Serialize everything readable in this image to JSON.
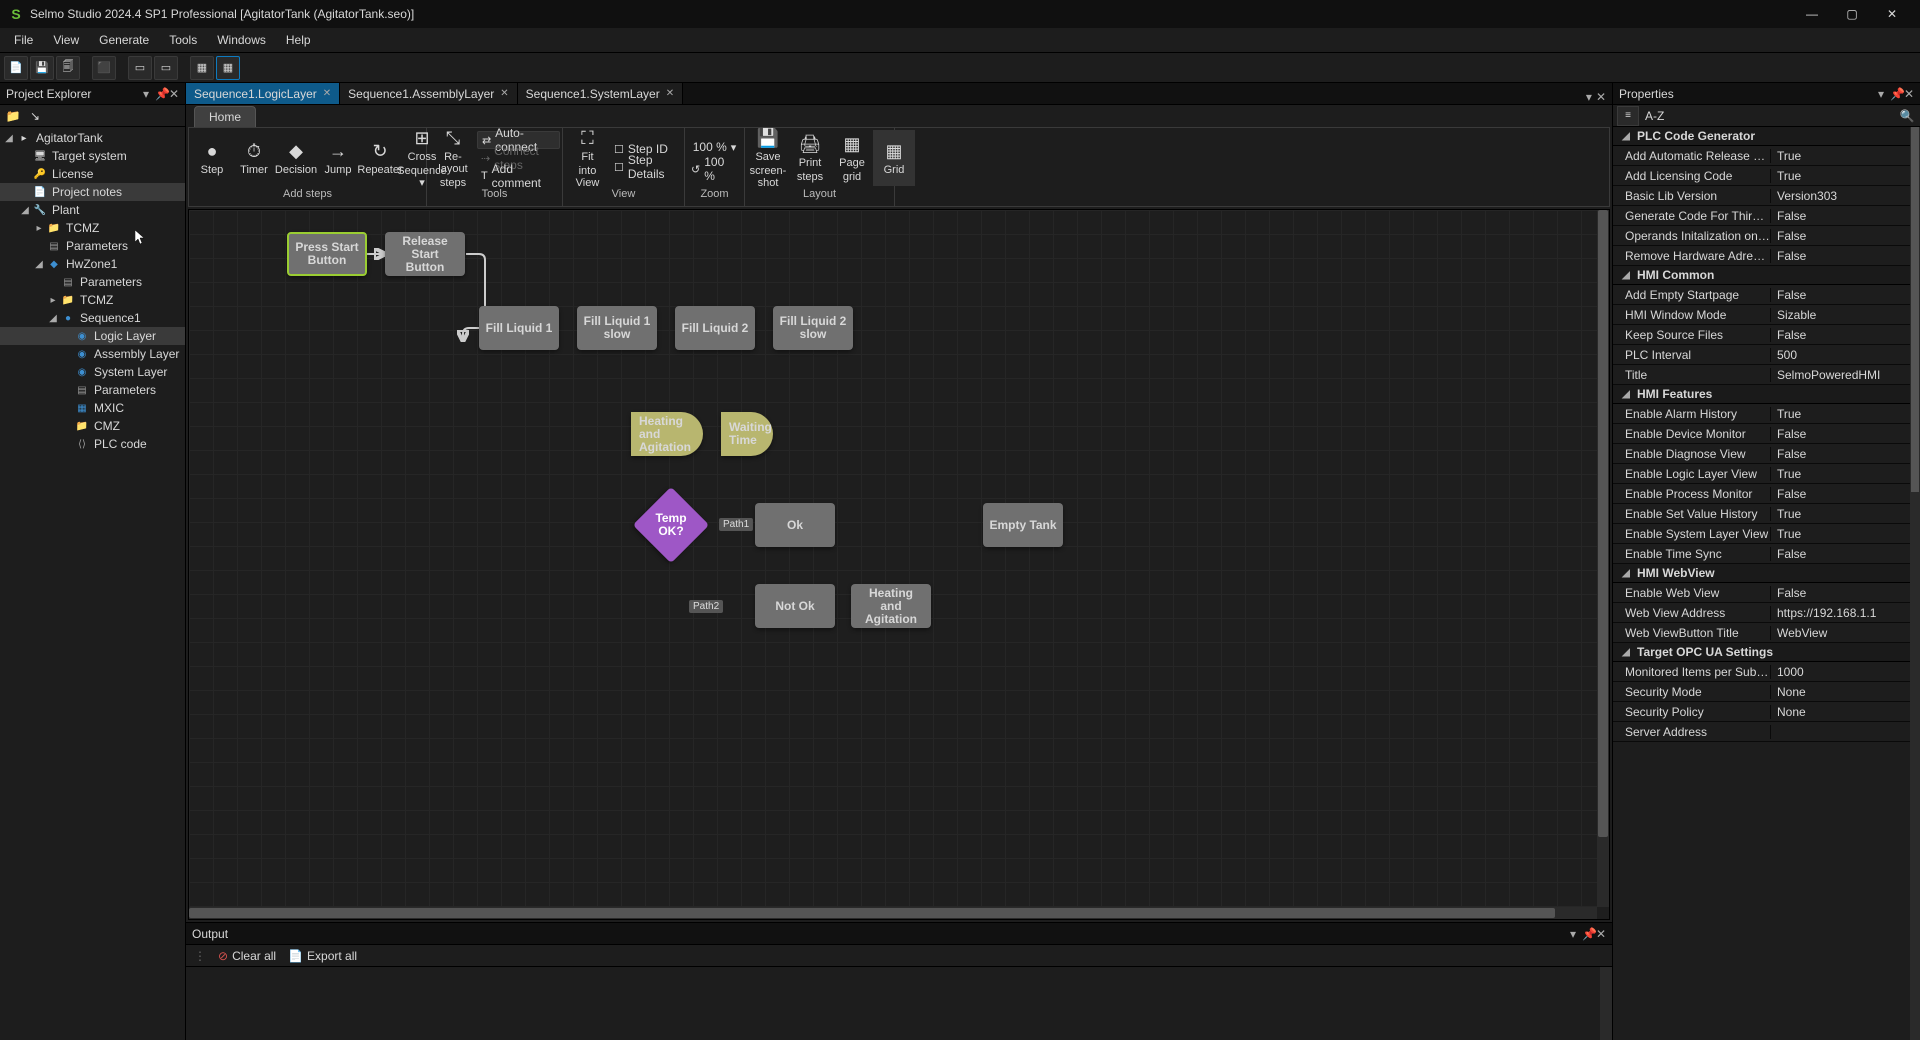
{
  "title": "Selmo Studio 2024.4 SP1 Professional  [AgitatorTank (AgitatorTank.seo)]",
  "menu": [
    "File",
    "View",
    "Generate",
    "Tools",
    "Windows",
    "Help"
  ],
  "leftPanel": {
    "title": "Project Explorer"
  },
  "tree": {
    "root": "AgitatorTank",
    "items": [
      {
        "pad": 1,
        "icon": "🖥",
        "label": "Target system"
      },
      {
        "pad": 1,
        "icon": "🔑",
        "label": "License",
        "iconCls": "fold"
      },
      {
        "pad": 1,
        "icon": "📄",
        "label": "Project notes",
        "sel": true
      },
      {
        "pad": 1,
        "exp": "◢",
        "icon": "🔧",
        "label": "Plant",
        "iconCls": "grey"
      },
      {
        "pad": 2,
        "exp": "▸",
        "icon": "📁",
        "label": "TCMZ",
        "iconCls": "fold"
      },
      {
        "pad": 2,
        "icon": "▤",
        "label": "Parameters",
        "iconCls": "grey"
      },
      {
        "pad": 2,
        "exp": "◢",
        "icon": "◆",
        "label": "HwZone1",
        "iconCls": "blue"
      },
      {
        "pad": 3,
        "icon": "▤",
        "label": "Parameters",
        "iconCls": "grey"
      },
      {
        "pad": 3,
        "exp": "▸",
        "icon": "📁",
        "label": "TCMZ",
        "iconCls": "fold"
      },
      {
        "pad": 3,
        "exp": "◢",
        "icon": "●",
        "label": "Sequence1",
        "iconCls": "blue"
      },
      {
        "pad": 4,
        "icon": "◉",
        "label": "Logic Layer",
        "iconCls": "blue",
        "sel": true
      },
      {
        "pad": 4,
        "icon": "◉",
        "label": "Assembly Layer",
        "iconCls": "blue"
      },
      {
        "pad": 4,
        "icon": "◉",
        "label": "System Layer",
        "iconCls": "blue"
      },
      {
        "pad": 4,
        "icon": "▤",
        "label": "Parameters",
        "iconCls": "grey"
      },
      {
        "pad": 4,
        "icon": "▦",
        "label": "MXIC",
        "iconCls": "blue"
      },
      {
        "pad": 4,
        "icon": "📁",
        "label": "CMZ",
        "iconCls": "fold"
      },
      {
        "pad": 4,
        "icon": "⟨⟩",
        "label": "PLC code",
        "iconCls": "grey"
      }
    ]
  },
  "docTabs": [
    {
      "label": "Sequence1.LogicLayer",
      "active": true
    },
    {
      "label": "Sequence1.AssemblyLayer"
    },
    {
      "label": "Sequence1.SystemLayer"
    }
  ],
  "ribbonHome": "Home",
  "ribbon": {
    "addSteps": {
      "label": "Add steps",
      "btns": [
        {
          "ic": "●",
          "t1": "Step"
        },
        {
          "ic": "⏱",
          "t1": "Timer"
        },
        {
          "ic": "◆",
          "t1": "Decision"
        },
        {
          "ic": "→",
          "t1": "Jump"
        },
        {
          "ic": "↻",
          "t1": "Repeater"
        },
        {
          "ic": "⊞",
          "t1": "Cross",
          "t2": "Sequence ▾"
        }
      ]
    },
    "tools": {
      "label": "Tools",
      "relayout": {
        "t1": "Re-layout",
        "t2": "steps"
      },
      "small": [
        {
          "t": "Auto-connect",
          "on": true
        },
        {
          "t": "Connect steps",
          "dis": true
        },
        {
          "t": "Add comment"
        }
      ]
    },
    "view": {
      "label": "View",
      "fit": {
        "t1": "Fit",
        "t2": "into View"
      },
      "small": [
        {
          "t": "Step ID"
        },
        {
          "t": "Step Details"
        }
      ]
    },
    "zoom": {
      "label": "Zoom",
      "in": "100 %",
      "reset": "100 %"
    },
    "layout": {
      "label": "Layout",
      "btns": [
        {
          "ic": "💾",
          "t1": "Save",
          "t2": "screen-shot"
        },
        {
          "ic": "🖨",
          "t1": "Print",
          "t2": "steps"
        },
        {
          "ic": "▦",
          "t1": "Page",
          "t2": "grid"
        },
        {
          "ic": "▦",
          "t1": "Grid",
          "on": true
        }
      ]
    }
  },
  "nodes": {
    "n1": "Press Start Button",
    "n2": "Release Start Button",
    "n3": "Fill Liquid 1",
    "n4": "Fill Liquid 1 slow",
    "n5": "Fill Liquid 2",
    "n6": "Fill Liquid 2 slow",
    "n7": "Heating and Agitation",
    "n8": "Waiting Time",
    "n9": "Temp OK?",
    "p1": "Path1",
    "n10": "Ok",
    "n11": "Empty Tank",
    "p2": "Path2",
    "n12": "Not Ok",
    "n13": "Heating and Agitation"
  },
  "output": {
    "title": "Output",
    "clear": "Clear all",
    "export": "Export all"
  },
  "propsPanel": {
    "title": "Properties",
    "sort": "A-Z"
  },
  "props": [
    {
      "cat": "PLC Code Generator"
    },
    {
      "k": "Add Automatic Release Jumps",
      "v": "True"
    },
    {
      "k": "Add Licensing Code",
      "v": "True"
    },
    {
      "k": "Basic Lib Version",
      "v": "Version303"
    },
    {
      "k": "Generate Code For Third Party HMI",
      "v": "False"
    },
    {
      "k": "Operands Initalization once",
      "v": "False"
    },
    {
      "k": "Remove Hardware Adress Declaration",
      "v": "False"
    },
    {
      "cat": "HMI Common"
    },
    {
      "k": "Add Empty Startpage",
      "v": "False"
    },
    {
      "k": "HMI Window Mode",
      "v": "Sizable"
    },
    {
      "k": "Keep Source Files",
      "v": "False"
    },
    {
      "k": "PLC Interval",
      "v": "500"
    },
    {
      "k": "Title",
      "v": "SelmoPoweredHMI"
    },
    {
      "cat": "HMI Features"
    },
    {
      "k": "Enable Alarm History",
      "v": "True"
    },
    {
      "k": "Enable Device Monitor",
      "v": "False"
    },
    {
      "k": "Enable Diagnose View",
      "v": "False"
    },
    {
      "k": "Enable Logic Layer View",
      "v": "True"
    },
    {
      "k": "Enable Process Monitor",
      "v": "False"
    },
    {
      "k": "Enable Set Value History",
      "v": "True"
    },
    {
      "k": "Enable System Layer View",
      "v": "True"
    },
    {
      "k": "Enable Time Sync",
      "v": "False"
    },
    {
      "cat": "HMI WebView"
    },
    {
      "k": "Enable Web View",
      "v": "False"
    },
    {
      "k": "Web View Address",
      "v": "https://192.168.1.1"
    },
    {
      "k": "Web ViewButton Title",
      "v": "WebView"
    },
    {
      "cat": "Target OPC UA Settings"
    },
    {
      "k": "Monitored Items per Subscription",
      "v": "1000"
    },
    {
      "k": "Security Mode",
      "v": "None"
    },
    {
      "k": "Security Policy",
      "v": "None"
    },
    {
      "k": "Server Address",
      "v": ""
    }
  ]
}
